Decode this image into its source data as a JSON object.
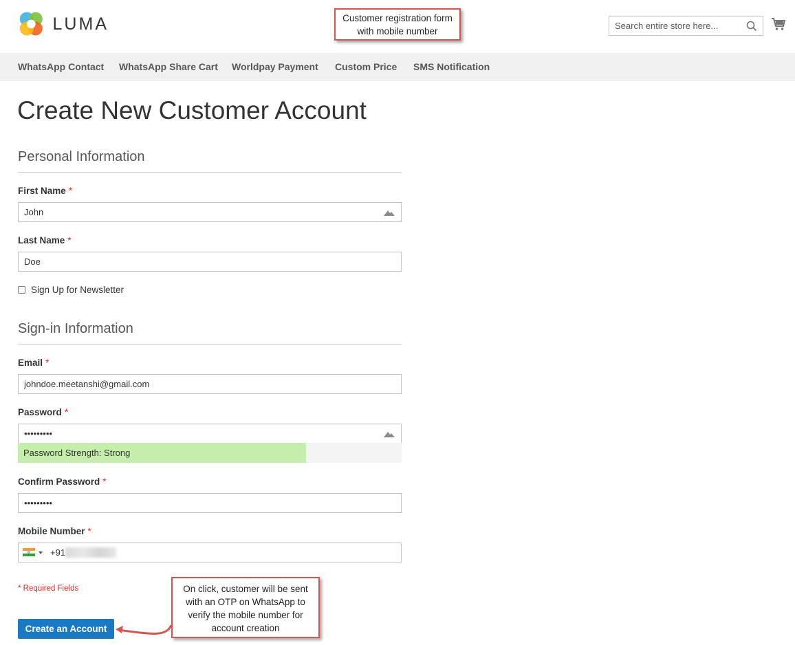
{
  "header": {
    "logo_text": "LUMA",
    "search_placeholder": "Search entire store here...",
    "annotation": "Customer registration form with mobile number"
  },
  "nav": {
    "items": [
      "WhatsApp Contact",
      "WhatsApp Share Cart",
      "Worldpay Payment",
      "Custom Price",
      "SMS Notification"
    ]
  },
  "page": {
    "title": "Create New Customer Account"
  },
  "personal": {
    "title": "Personal Information",
    "first_name_label": "First Name",
    "first_name_value": "John",
    "last_name_label": "Last Name",
    "last_name_value": "Doe",
    "newsletter_label": "Sign Up for Newsletter"
  },
  "signin": {
    "title": "Sign-in Information",
    "email_label": "Email",
    "email_value": "johndoe.meetanshi@gmail.com",
    "password_label": "Password",
    "password_value": "•••••••••",
    "strength_text": "Password Strength: Strong",
    "strength_level": 0.75,
    "confirm_label": "Confirm Password",
    "confirm_value": "•••••••••",
    "mobile_label": "Mobile Number",
    "dial_code": "+91"
  },
  "footer": {
    "required_note": "* Required Fields",
    "create_button": "Create an Account",
    "annotation": "On click, customer will be sent with an OTP on WhatsApp to verify the mobile number for account creation"
  },
  "colors": {
    "primary": "#1979c3",
    "required": "#e02b27",
    "strength_fill": "#c5eeac",
    "annotation_border": "#d9534f"
  },
  "icons": {
    "search": "search-icon",
    "cart": "cart-icon",
    "autofill": "autofill-key-icon",
    "flag": "india-flag-icon"
  }
}
